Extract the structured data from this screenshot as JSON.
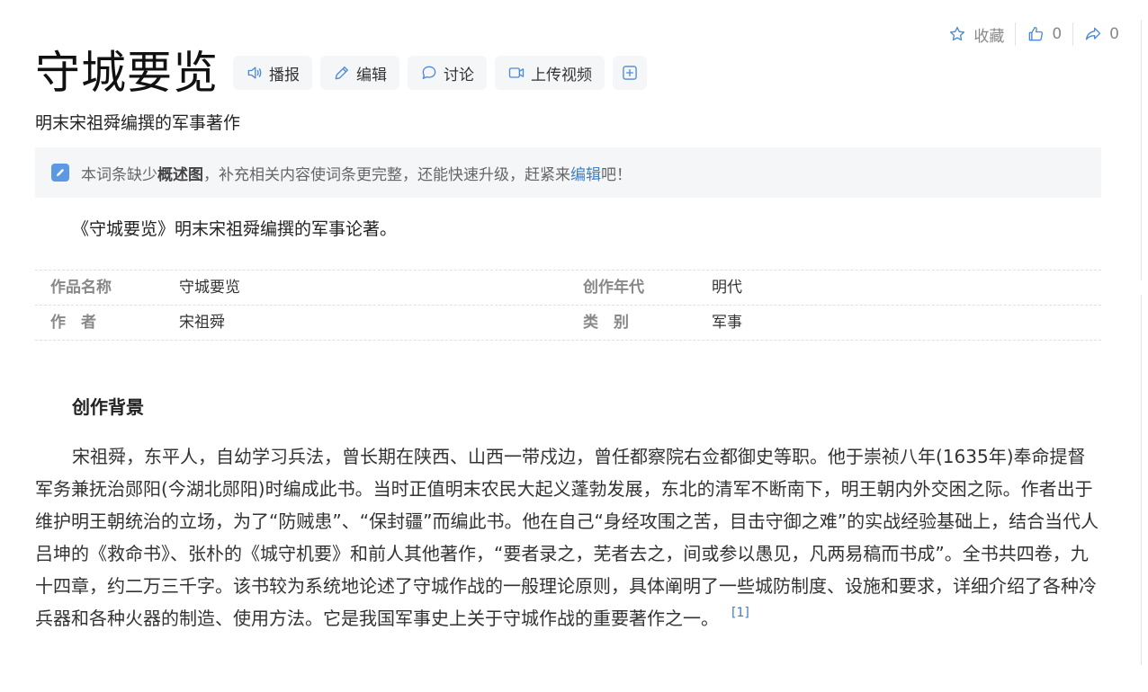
{
  "top_actions": {
    "favorite_label": "收藏",
    "like_count": "0",
    "share_count": "0"
  },
  "title": "守城要览",
  "toolbar": {
    "broadcast_label": "播报",
    "edit_label": "编辑",
    "discuss_label": "讨论",
    "upload_video_label": "上传视频"
  },
  "subtitle": "明末宋祖舜编撰的军事著作",
  "notice": {
    "prefix": "本词条缺少",
    "bold": "概述图",
    "middle": "，补充相关内容使词条更完整，还能快速升级，赶紧来",
    "link": "编辑",
    "suffix": "吧！"
  },
  "summary": "《守城要览》明末宋祖舜编撰的军事论著。",
  "basic_info": {
    "rows": [
      {
        "k1": "作品名称",
        "v1": "守城要览",
        "k2": "创作年代",
        "v2": "明代"
      },
      {
        "k1": "作　者",
        "v1": "宋祖舜",
        "k2": "类　别",
        "v2": "军事"
      }
    ]
  },
  "section": {
    "title": "创作背景",
    "paragraph": "宋祖舜，东平人，自幼学习兵法，曾长期在陕西、山西一带戍边，曾任都察院右佥都御史等职。他于崇祯八年(1635年)奉命提督军务兼抚治郧阳(今湖北郧阳)时编成此书。当时正值明末农民大起义蓬勃发展，东北的清军不断南下，明王朝内外交困之际。作者出于维护明王朝统治的立场，为了“防贼患”、“保封疆”而编此书。他在自己“身经攻围之苦，目击守御之难”的实战经验基础上，结合当代人吕坤的《救命书》、张朴的《城守机要》和前人其他著作，“要者录之，芜者去之，间或参以愚见，凡两易稿而书成”。全书共四卷，九十四章，约二万三千字。该书较为系统地论述了守城作战的一般理论原则，具体阐明了一些城防制度、设施和要求，详细介绍了各种冷兵器和各种火器的制造、使用方法。它是我国军事史上关于守城作战的重要著作之一。",
    "ref": "[1]"
  },
  "colors": {
    "accent": "#3d7ec4",
    "icon_blue": "#5b9ae3",
    "button_bg": "#f5f6f8"
  }
}
